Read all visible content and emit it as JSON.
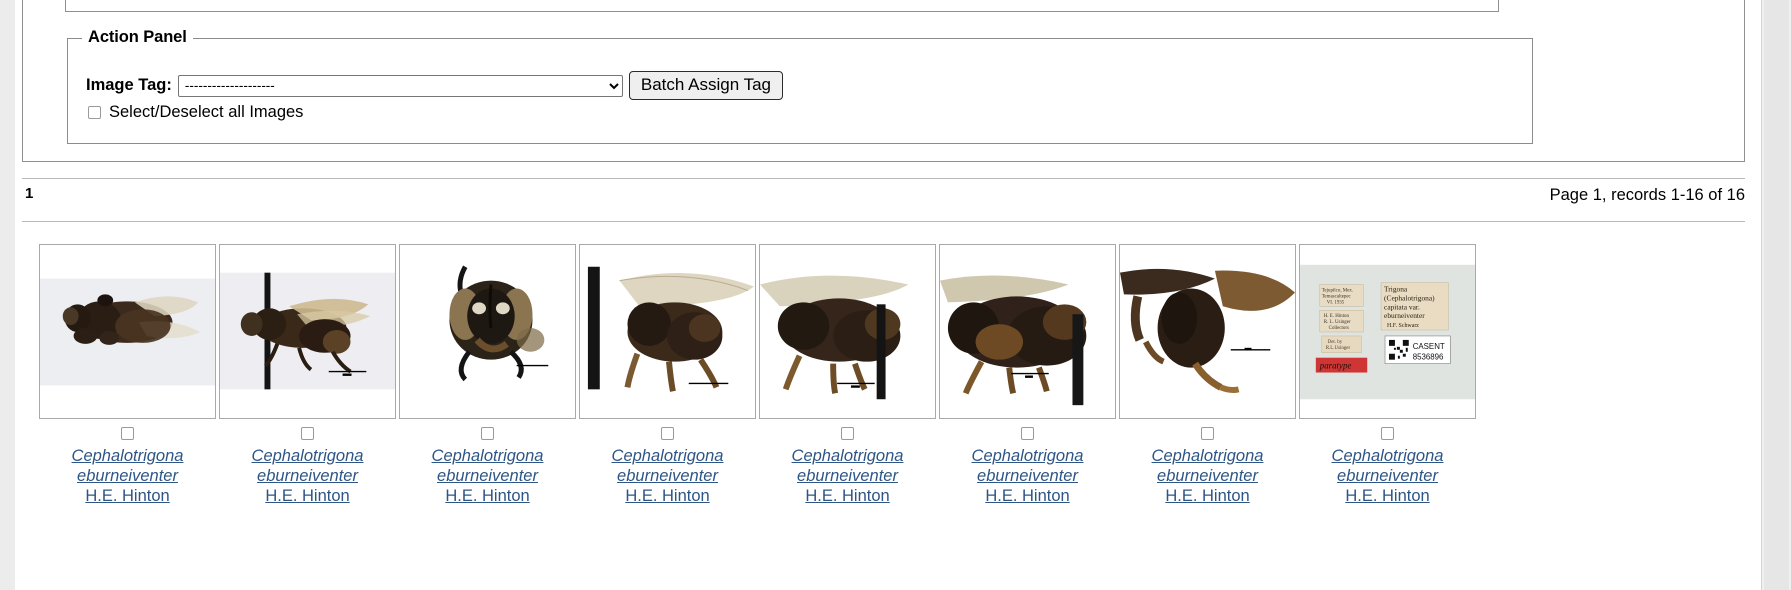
{
  "action_panel": {
    "legend": "Action Panel",
    "image_tag_label": "Image Tag:",
    "tag_select_value": "--------------------",
    "tag_options": [
      "--------------------"
    ],
    "batch_button_label": "Batch Assign Tag",
    "select_all_label": "Select/Deselect all Images"
  },
  "pagination": {
    "current_page": "1",
    "records_text": "Page 1, records 1-16 of 16"
  },
  "colors": {
    "link": "#2d5586",
    "border": "#a9a9a9",
    "panel_border": "#8c8c8c",
    "scrollbar": "#e6e6e6"
  },
  "thumbnails": [
    {
      "sci_name": "Cephalotrigona eburneiventer",
      "author": "H.E. Hinton",
      "view": "dorsal habitus",
      "checked": false
    },
    {
      "sci_name": "Cephalotrigona eburneiventer",
      "author": "H.E. Hinton",
      "view": "lateral habitus with pin",
      "checked": false
    },
    {
      "sci_name": "Cephalotrigona eburneiventer",
      "author": "H.E. Hinton",
      "view": "head frontal",
      "checked": false
    },
    {
      "sci_name": "Cephalotrigona eburneiventer",
      "author": "H.E. Hinton",
      "view": "lateral close-up wing",
      "checked": false
    },
    {
      "sci_name": "Cephalotrigona eburneiventer",
      "author": "H.E. Hinton",
      "view": "thorax lateral",
      "checked": false
    },
    {
      "sci_name": "Cephalotrigona eburneiventer",
      "author": "H.E. Hinton",
      "view": "mesosoma detail",
      "checked": false
    },
    {
      "sci_name": "Cephalotrigona eburneiventer",
      "author": "H.E. Hinton",
      "view": "hind leg detail",
      "checked": false
    },
    {
      "sci_name": "Cephalotrigona eburneiventer",
      "author": "H.E. Hinton",
      "view": "specimen labels",
      "checked": false,
      "labels": {
        "locality_line1": "Tejupilco, Mex.",
        "locality_line2": "Temascaltepec",
        "locality_line3": "VI. 1935",
        "collector_line1": "H. E. Hinton",
        "collector_line2": "R. L. Usinger",
        "collector_line3": "Collectors",
        "det_line1": "Det. by",
        "det_line2": "R.L.Usinger",
        "type_label": "paratype",
        "determination_line1": "Trigona",
        "determination_line2": "(Cephalotrigona)",
        "determination_line3": "capitata var.",
        "determination_line4": "eburneiventer",
        "determination_line5": "H.F. Schwarz",
        "catalog_code": "CASENT",
        "catalog_number": "8536896"
      }
    }
  ]
}
